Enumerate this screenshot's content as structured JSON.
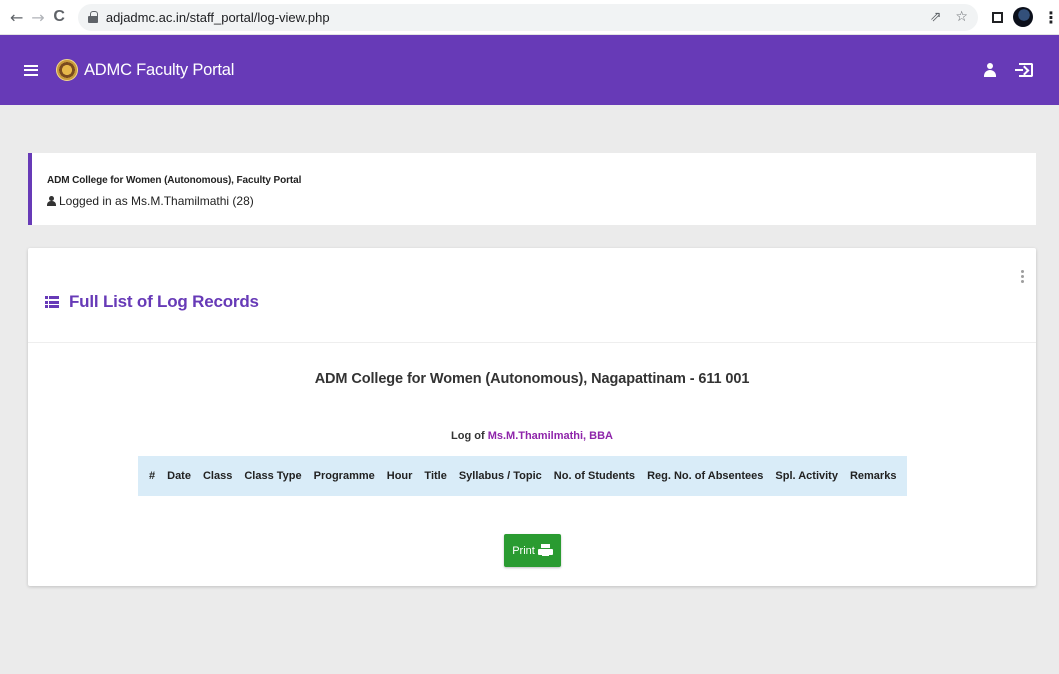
{
  "browser": {
    "url": "adjadmc.ac.in/staff_portal/log-view.php",
    "back_glyph": "←",
    "forward_glyph": "→",
    "reload_glyph": "C",
    "share_glyph": "⇗",
    "bookmark_glyph": "☆",
    "menu_glyph": "⋮"
  },
  "appbar": {
    "brand": "ADMC Faculty Portal",
    "color": "#673ab7"
  },
  "info": {
    "portal_line": "ADM College for Women (Autonomous), Faculty Portal",
    "logged_in": "Logged in as Ms.M.Thamilmathi (28)"
  },
  "card": {
    "title": "Full List of Log Records",
    "college_heading": "ADM College for Women (Autonomous), Nagapattinam - 611 001",
    "log_of_prefix": "Log of",
    "log_of_name": "Ms.M.Thamilmathi, BBA",
    "columns": [
      "#",
      "Date",
      "Class",
      "Class Type",
      "Programme",
      "Hour",
      "Title",
      "Syllabus / Topic",
      "No. of Students",
      "Reg. No. of Absentees",
      "Spl. Activity",
      "Remarks"
    ],
    "print_label": "Print",
    "print_color": "#2a9b31"
  }
}
